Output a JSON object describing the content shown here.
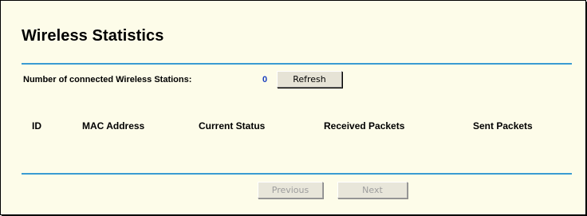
{
  "page": {
    "title": "Wireless Statistics",
    "stations_label": "Number of connected Wireless Stations:",
    "stations_count": "0"
  },
  "buttons": {
    "refresh": "Refresh",
    "previous": "Previous",
    "next": "Next"
  },
  "table": {
    "columns": [
      "ID",
      "MAC Address",
      "Current Status",
      "Received Packets",
      "Sent Packets"
    ],
    "rows": []
  },
  "colors": {
    "panel_background": "#fdfce9",
    "rule": "#3a9bd2",
    "count": "#1a3fbf"
  }
}
